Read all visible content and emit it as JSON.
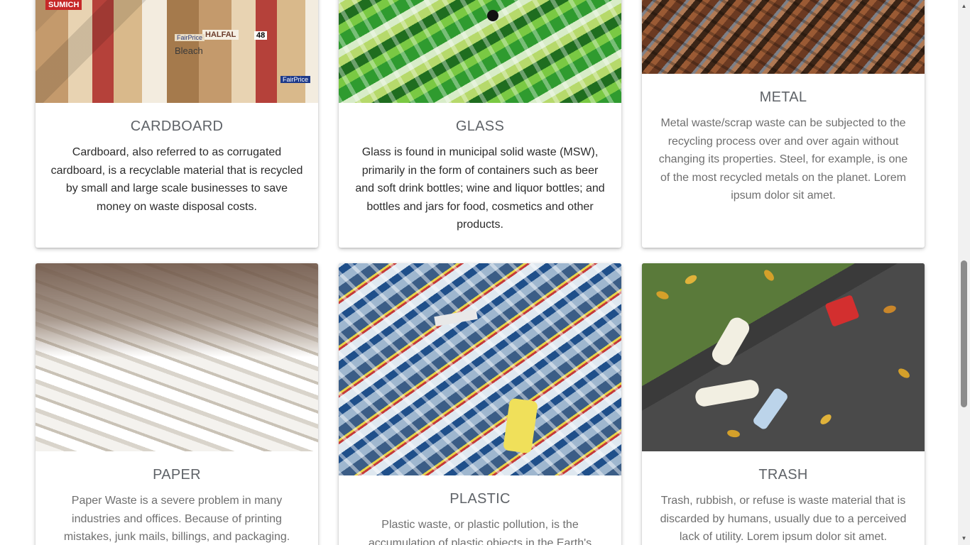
{
  "cards": [
    {
      "title": "CARDBOARD",
      "text": "Cardboard, also referred to as corrugated cardboard, is a recyclable material that is recycled by small and large scale businesses to save money on waste disposal costs.",
      "image_labels": [
        "SUMICH",
        "HALFAL",
        "FairPrice",
        "Bleach",
        "FairPrice",
        "48"
      ]
    },
    {
      "title": "GLASS",
      "text": "Glass is found in municipal solid waste (MSW), primarily in the form of containers such as beer and soft drink bottles; wine and liquor bottles; and bottles and jars for food, cosmetics and other products."
    },
    {
      "title": "METAL",
      "text": "Metal waste/scrap waste can be subjected to the recycling process over and over again without changing its properties. Steel, for example, is one of the most recycled metals on the planet. Lorem ipsum dolor sit amet."
    },
    {
      "title": "PAPER",
      "text": "Paper Waste is a severe problem in many industries and offices. Because of printing mistakes, junk mails, billings, and packaging."
    },
    {
      "title": "PLASTIC",
      "text": "Plastic waste, or plastic pollution, is the accumulation of plastic objects in the Earth's"
    },
    {
      "title": "TRASH",
      "text": "Trash, rubbish, or refuse is waste material that is discarded by humans, usually due to a perceived lack of utility. Lorem ipsum dolor sit amet."
    }
  ],
  "colors": {
    "title": "#5f6368",
    "text_dark": "#2b2b2b",
    "text_muted": "#6f6f6f"
  }
}
